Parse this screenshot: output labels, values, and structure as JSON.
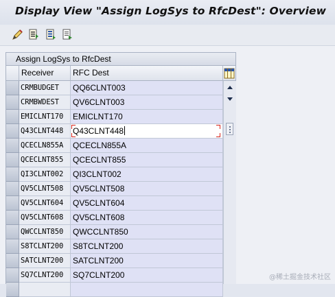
{
  "window": {
    "title": "Display View \"Assign LogSys to RfcDest\": Overview"
  },
  "toolbar": {
    "icons": [
      "change-display-icon",
      "details-icon",
      "select-all-icon",
      "print-icon"
    ]
  },
  "table": {
    "caption": "Assign LogSys to RfcDest",
    "columns": {
      "receiver": "Receiver",
      "rfc_dest": "RFC Dest"
    },
    "rows": [
      {
        "receiver": "CRMBUDGET",
        "rfc_dest": "QQ6CLNT003"
      },
      {
        "receiver": "CRMBWDEST",
        "rfc_dest": "QV6CLNT003"
      },
      {
        "receiver": "EMICLNT170",
        "rfc_dest": "EMICLNT170"
      },
      {
        "receiver": "Q43CLNT448",
        "rfc_dest": "Q43CLNT448"
      },
      {
        "receiver": "QCECLN855A",
        "rfc_dest": "QCECLN855A"
      },
      {
        "receiver": "QCECLNT855",
        "rfc_dest": "QCECLNT855"
      },
      {
        "receiver": "QI3CLNT002",
        "rfc_dest": "QI3CLNT002"
      },
      {
        "receiver": "QV5CLNT508",
        "rfc_dest": "QV5CLNT508"
      },
      {
        "receiver": "QV5CLNT604",
        "rfc_dest": "QV5CLNT604"
      },
      {
        "receiver": "QV5CLNT608",
        "rfc_dest": "QV5CLNT608"
      },
      {
        "receiver": "QWCCLNT850",
        "rfc_dest": "QWCCLNT850"
      },
      {
        "receiver": "S8TCLNT200",
        "rfc_dest": "S8TCLNT200"
      },
      {
        "receiver": "SATCLNT200",
        "rfc_dest": "SATCLNT200"
      },
      {
        "receiver": "SQ7CLNT200",
        "rfc_dest": "SQ7CLNT200"
      },
      {
        "receiver": "",
        "rfc_dest": ""
      }
    ],
    "active_row": 3
  },
  "watermark": "@稀土掘金技术社区",
  "colors": {
    "accent_red": "#d9241a",
    "cell_bg": "#dfe1f5",
    "title_bg": "#dde2ec"
  }
}
